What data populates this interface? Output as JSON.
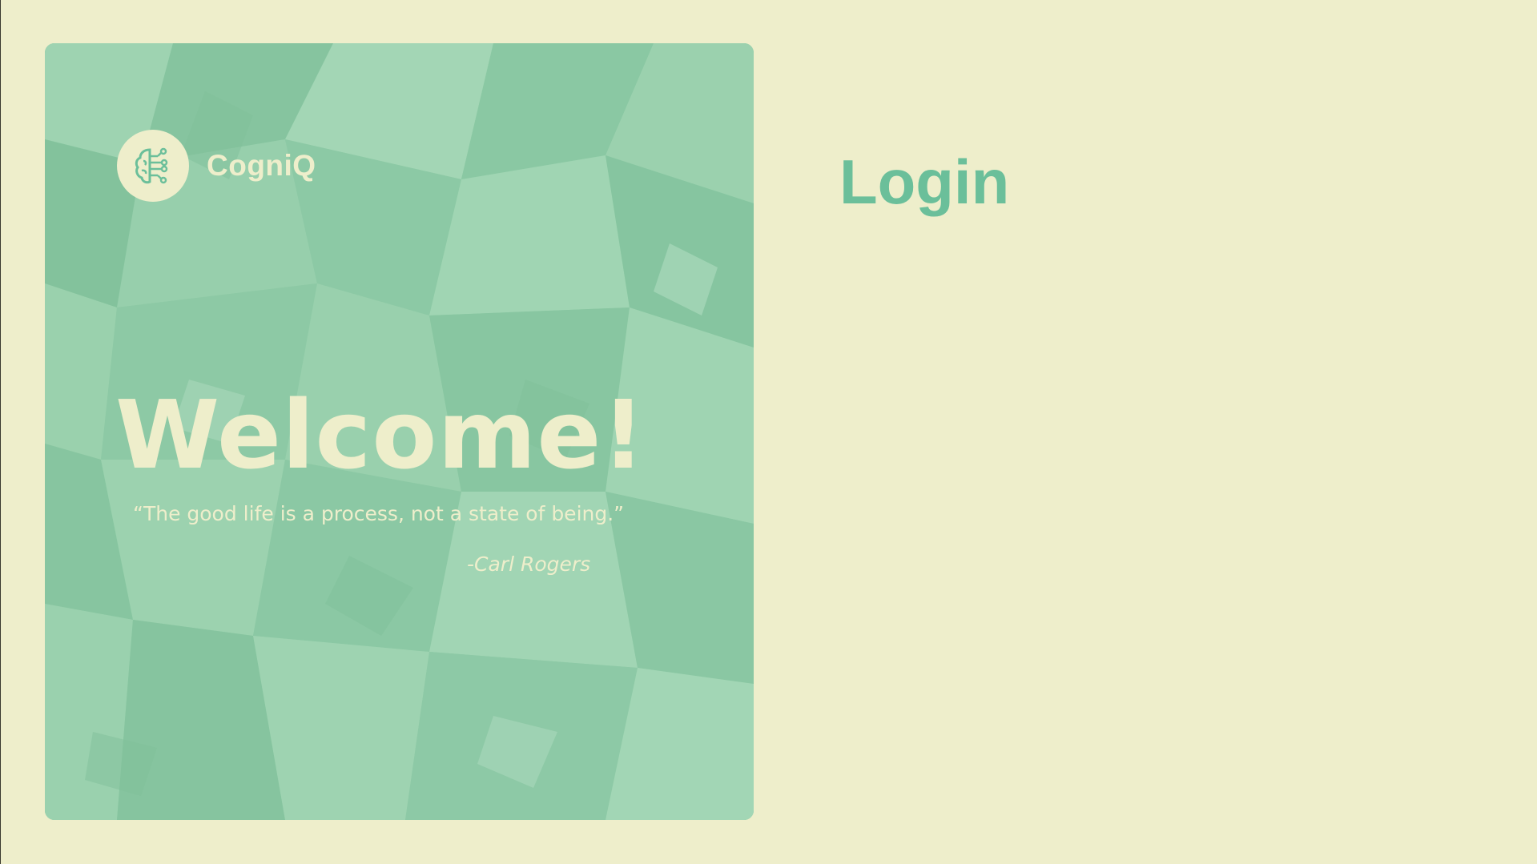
{
  "brand": {
    "name": "CogniQ",
    "logo_icon": "brain-circuit-icon"
  },
  "hero": {
    "welcome": "Welcome!",
    "quote": "“The good life is a process, not a state of being.”",
    "author": "-Carl Rogers",
    "background_icon": "crumpled-paper-texture"
  },
  "login": {
    "title": "Login"
  },
  "colors": {
    "page_background": "#eeeecb",
    "hero_green": "#8fcba6",
    "accent_green": "#6bbf9a",
    "cream_text": "#eeeecb"
  }
}
